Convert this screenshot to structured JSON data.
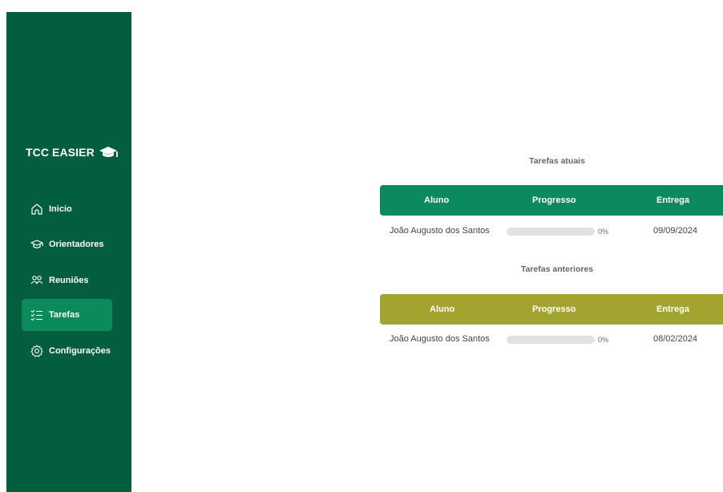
{
  "sidebar": {
    "brand": "TCC EASIER",
    "items": [
      {
        "label": "Inicio",
        "icon": "home-icon",
        "active": false
      },
      {
        "label": "Orientadores",
        "icon": "graduation-cap-icon",
        "active": false
      },
      {
        "label": "Reuniões",
        "icon": "users-icon",
        "active": false
      },
      {
        "label": "Tarefas",
        "icon": "checklist-icon",
        "active": true
      },
      {
        "label": "Configurações",
        "icon": "gear-icon",
        "active": false
      }
    ]
  },
  "colors": {
    "sidebar_bg": "#035e3f",
    "active_item": "#0b8a5c",
    "current_header": "#0a8a5e",
    "previous_header": "#a3a32f"
  },
  "current_tasks": {
    "title": "Tarefas atuais",
    "headers": [
      "Aluno",
      "Progresso",
      "Entrega"
    ],
    "rows": [
      {
        "student": "João Augusto dos Santos",
        "progress": 0,
        "progress_label": "0%",
        "due": "09/09/2024"
      }
    ]
  },
  "previous_tasks": {
    "title": "Tarefas anteriores",
    "headers": [
      "Aluno",
      "Progresso",
      "Entrega"
    ],
    "rows": [
      {
        "student": "João Augusto dos Santos",
        "progress": 0,
        "progress_label": "0%",
        "due": "08/02/2024"
      }
    ]
  }
}
